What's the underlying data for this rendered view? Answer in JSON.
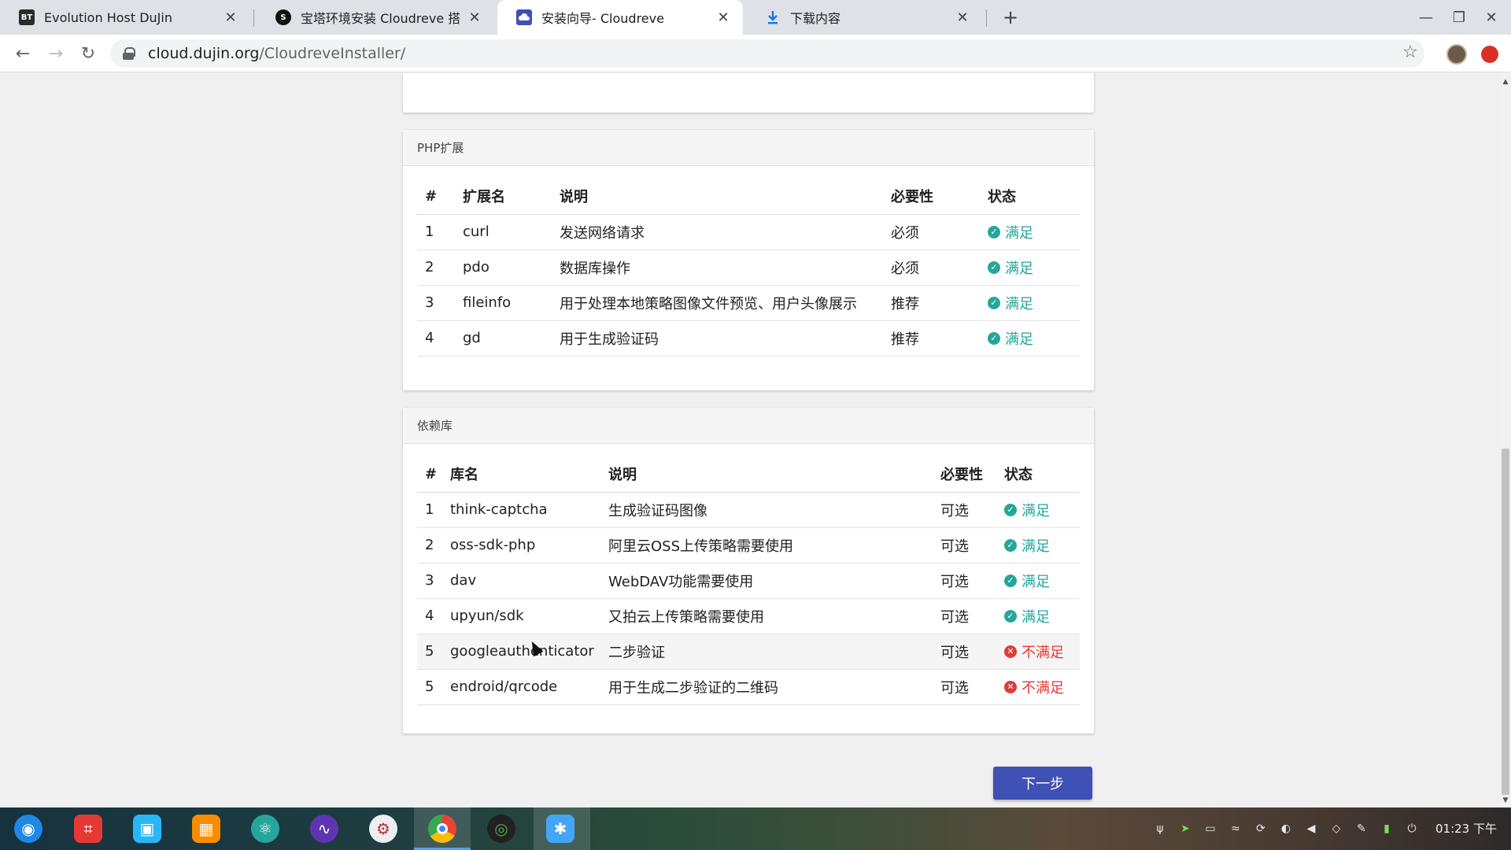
{
  "browser": {
    "tabs": [
      {
        "title": "Evolution Host DuJin",
        "favicon_text": "BT",
        "active": false
      },
      {
        "title": "宝塔环境安装 Cloudreve 搭建私有",
        "favicon_text": "S",
        "active": false
      },
      {
        "title": "安装向导- Cloudreve",
        "favicon_text": "",
        "active": true
      },
      {
        "title": "下载内容",
        "favicon_text": "",
        "active": false
      }
    ],
    "new_tab": "+",
    "close_glyph": "✕",
    "url_host": "cloud.dujin.org",
    "url_path": "/CloudreveInstaller/",
    "nav": {
      "back": "←",
      "forward": "→",
      "reload": "↻",
      "star": "☆"
    },
    "window": {
      "minimize": "—",
      "restore": "❐",
      "close": "✕"
    }
  },
  "php_ext": {
    "header": "PHP扩展",
    "columns": [
      "#",
      "扩展名",
      "说明",
      "必要性",
      "状态"
    ],
    "rows": [
      {
        "n": "1",
        "name": "curl",
        "desc": "发送网络请求",
        "need": "必须",
        "status": "满足",
        "ok": true
      },
      {
        "n": "2",
        "name": "pdo",
        "desc": "数据库操作",
        "need": "必须",
        "status": "满足",
        "ok": true
      },
      {
        "n": "3",
        "name": "fileinfo",
        "desc": "用于处理本地策略图像文件预览、用户头像展示",
        "need": "推荐",
        "status": "满足",
        "ok": true
      },
      {
        "n": "4",
        "name": "gd",
        "desc": "用于生成验证码",
        "need": "推荐",
        "status": "满足",
        "ok": true
      }
    ]
  },
  "deps": {
    "header": "依赖库",
    "columns": [
      "#",
      "库名",
      "说明",
      "必要性",
      "状态"
    ],
    "rows": [
      {
        "n": "1",
        "name": "think-captcha",
        "desc": "生成验证码图像",
        "need": "可选",
        "status": "满足",
        "ok": true
      },
      {
        "n": "2",
        "name": "oss-sdk-php",
        "desc": "阿里云OSS上传策略需要使用",
        "need": "可选",
        "status": "满足",
        "ok": true
      },
      {
        "n": "3",
        "name": "dav",
        "desc": "WebDAV功能需要使用",
        "need": "可选",
        "status": "满足",
        "ok": true
      },
      {
        "n": "4",
        "name": "upyun/sdk",
        "desc": "又拍云上传策略需要使用",
        "need": "可选",
        "status": "满足",
        "ok": true
      },
      {
        "n": "5",
        "name": "googleauthenticator",
        "desc": "二步验证",
        "need": "可选",
        "status": "不满足",
        "ok": false
      },
      {
        "n": "5",
        "name": "endroid/qrcode",
        "desc": "用于生成二步验证的二维码",
        "need": "可选",
        "status": "不满足",
        "ok": false
      }
    ]
  },
  "next_button": "下一步",
  "colors": {
    "ok": "#26a69a",
    "fail": "#e53935",
    "primary": "#3f51b5"
  },
  "taskbar": {
    "clock": "01:23 下午",
    "apps": [
      "launcher-icon",
      "screenshot-icon",
      "store-icon",
      "archive-icon",
      "atom-icon",
      "monitor-icon",
      "settings-icon",
      "chrome-icon",
      "camera-icon",
      "star-app-icon"
    ]
  }
}
